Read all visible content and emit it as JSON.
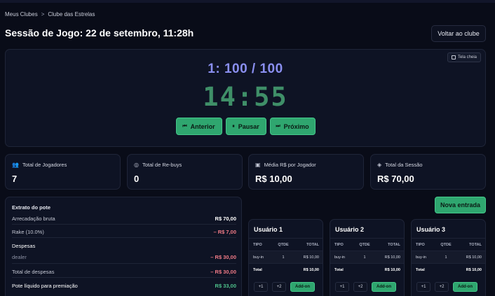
{
  "breadcrumb": {
    "root": "Meus Clubes",
    "separator": ">",
    "current": "Clube das Estrelas"
  },
  "header": {
    "title": "Sessão de Jogo: 22 de setembro, 11:28h",
    "back_label": "Voltar ao clube"
  },
  "timer": {
    "fullscreen_label": "Tela cheia",
    "blinds": "1: 100 / 100",
    "clock": "14:55",
    "prev_label": "Anterior",
    "pause_label": "Pausar",
    "next_label": "Próximo"
  },
  "stats": [
    {
      "label": "Total de Jogadores",
      "value": "7",
      "icon": "users-icon"
    },
    {
      "label": "Total de Re-buys",
      "value": "0",
      "icon": "coins-icon"
    },
    {
      "label": "Média R$ por Jogador",
      "value": "R$ 10,00",
      "icon": "wallet-icon"
    },
    {
      "label": "Total da Sessão",
      "value": "R$ 70,00",
      "icon": "tag-icon"
    }
  ],
  "pot": {
    "title": "Extrato do pote",
    "gross_label": "Arrecadação bruta",
    "gross_value": "R$ 70,00",
    "rake_label": "Rake (10.0%)",
    "rake_value": "– R$ 7,00",
    "expenses_label": "Despesas",
    "dealer_label": "dealer",
    "dealer_value": "– R$ 30,00",
    "total_expenses_label": "Total de despesas",
    "total_expenses_value": "– R$ 30,00",
    "net_label": "Pote líquido para premiação",
    "net_value": "R$ 33,00"
  },
  "new_entry_label": "Nova entrada",
  "table_headers": {
    "type": "TIPO",
    "qty": "QTDE",
    "total": "TOTAL"
  },
  "users": [
    {
      "name": "Usuário 1",
      "row": {
        "type": "buy-in",
        "qty": "1",
        "total": "R$ 10,00"
      },
      "total_label": "Total",
      "total_value": "R$ 10,00",
      "plus1": "+1",
      "plus2": "+2",
      "addon": "Add-on"
    },
    {
      "name": "Usuário 2",
      "row": {
        "type": "buy-in",
        "qty": "1",
        "total": "R$ 10,00"
      },
      "total_label": "Total",
      "total_value": "R$ 10,00",
      "plus1": "+1",
      "plus2": "+2",
      "addon": "Add-on"
    },
    {
      "name": "Usuário 3",
      "row": {
        "type": "buy-in",
        "qty": "1",
        "total": "R$ 10,00"
      },
      "total_label": "Total",
      "total_value": "R$ 10,00",
      "plus1": "+1",
      "plus2": "+2",
      "addon": "Add-on"
    }
  ],
  "colors": {
    "accent": "#2fa66f",
    "clock": "#3f8f68",
    "blinds": "#8a8ff0",
    "negative": "#f07a86",
    "positive": "#4ec28b",
    "background": "#090c18"
  }
}
